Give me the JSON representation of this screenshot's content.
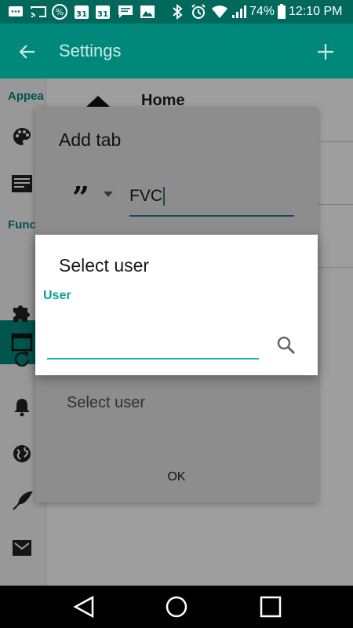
{
  "status_bar": {
    "battery_percent": "74%",
    "time": "12:10 PM",
    "calendar_day_1": "31",
    "calendar_day_2": "31",
    "icons": [
      "notification-icon",
      "cast-icon",
      "percent-icon",
      "calendar-icon",
      "calendar-icon",
      "message-icon",
      "image-icon",
      "bluetooth-icon",
      "alarm-icon",
      "wifi-icon",
      "signal-icon",
      "battery-icon"
    ]
  },
  "app_bar": {
    "title": "Settings",
    "back_icon": "arrow-left-icon",
    "add_icon": "plus-icon"
  },
  "sidebar": {
    "sections": [
      {
        "label": "Appea"
      },
      {
        "label": "Func"
      }
    ],
    "items": [
      {
        "icon": "palette-icon"
      },
      {
        "icon": "article-icon"
      },
      {
        "icon": "tab-icon",
        "selected": true
      },
      {
        "icon": "puzzle-icon"
      },
      {
        "icon": "refresh-icon"
      },
      {
        "icon": "bell-icon"
      },
      {
        "icon": "globe-icon"
      },
      {
        "icon": "feather-icon"
      },
      {
        "icon": "mail-icon"
      }
    ]
  },
  "background_list": {
    "first_item": "Home"
  },
  "add_tab_dialog": {
    "title": "Add tab",
    "type_icon": "quote-icon",
    "name_value": "FVC",
    "user_field_placeholder": "Select user",
    "ok_label": "OK"
  },
  "select_user_dialog": {
    "title": "Select user",
    "field_label": "User",
    "field_value": "",
    "search_icon": "search-icon"
  },
  "colors": {
    "primary_dark": "#00695c",
    "primary": "#00897b",
    "accent": "#25b5b0"
  },
  "nav_bar": {
    "buttons": [
      "back-triangle-icon",
      "home-circle-icon",
      "recents-square-icon"
    ]
  }
}
